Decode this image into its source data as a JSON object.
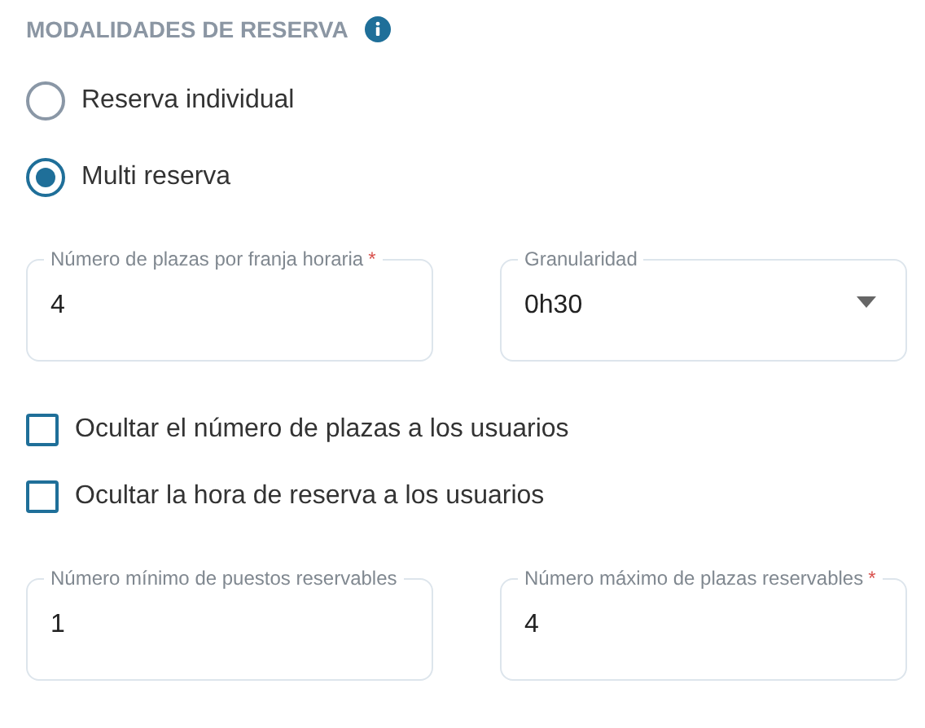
{
  "section": {
    "title": "MODALIDADES DE RESERVA"
  },
  "booking_modes": [
    {
      "label": "Reserva individual",
      "selected": false
    },
    {
      "label": "Multi reserva",
      "selected": true
    }
  ],
  "fields_top": [
    {
      "kind": "input",
      "label": "Número de plazas por franja horaria",
      "required_mark": "*",
      "value": "4"
    },
    {
      "kind": "select",
      "label": "Granularidad",
      "value": "0h30"
    }
  ],
  "options": [
    {
      "label": "Ocultar el número de plazas a los usuarios",
      "checked": false
    },
    {
      "label": "Ocultar la hora de reserva a los usuarios",
      "checked": false
    }
  ],
  "fields_bottom": [
    {
      "kind": "input",
      "label": "Número mínimo de puestos reservables",
      "value": "1"
    },
    {
      "kind": "input",
      "label": "Número máximo de plazas reservables",
      "required_mark": "*",
      "value": "4"
    }
  ]
}
